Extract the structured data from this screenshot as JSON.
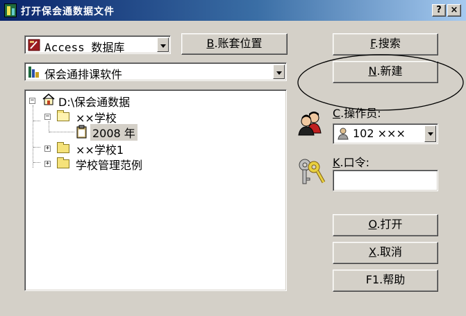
{
  "window": {
    "title": "打开保会通数据文件",
    "help_label": "?",
    "close_label": "×"
  },
  "db_type": {
    "value": "Access 数据库"
  },
  "software": {
    "value": "保会通排课软件"
  },
  "buttons": {
    "account_location": {
      "key": "B",
      "text": ".账套位置"
    },
    "search": {
      "key": "F",
      "text": ".搜索"
    },
    "new": {
      "key": "N",
      "text": ".新建"
    },
    "open": {
      "key": "O",
      "text": ".打开"
    },
    "cancel": {
      "key": "X",
      "text": ".取消"
    },
    "help": {
      "key": "F1",
      "text": ".帮助"
    }
  },
  "tree": {
    "root": "D:\\保会通数据",
    "school": "××学校",
    "year": "2008 年",
    "school1": "××学校1",
    "example": "学校管理范例",
    "minus": "−",
    "plus": "+"
  },
  "operator": {
    "label_key": "C",
    "label_text": ".操作员:",
    "value": "102 ×××"
  },
  "password": {
    "label_key": "K",
    "label_text": ".口令:",
    "value": ""
  }
}
